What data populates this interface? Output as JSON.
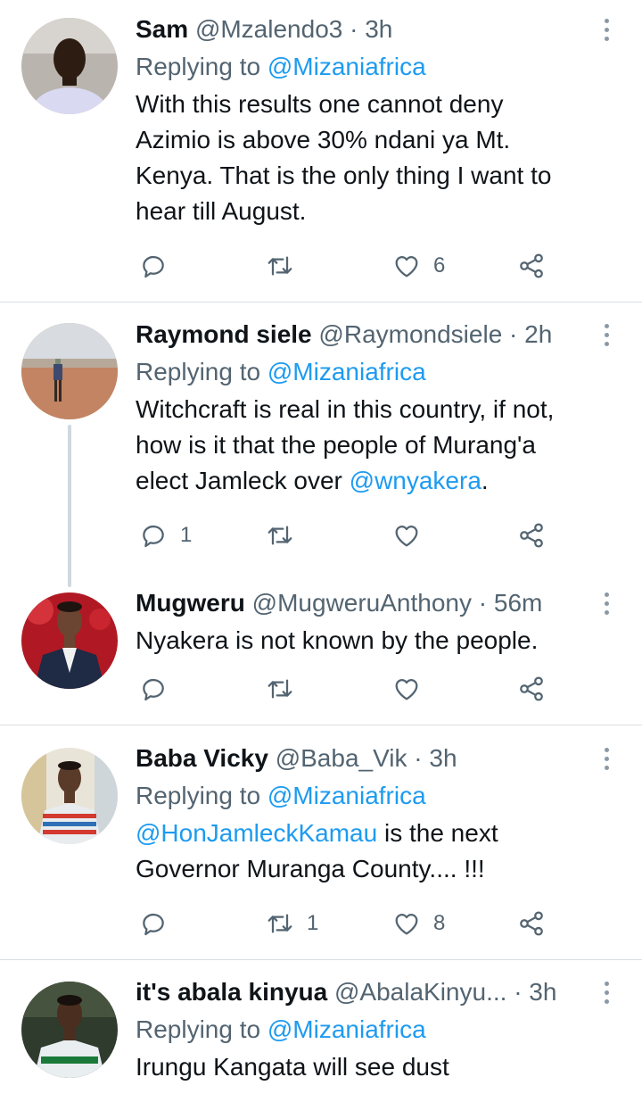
{
  "tweets": [
    {
      "name": "Sam",
      "handle": "@Mzalendo3",
      "dot": "·",
      "time": "3h",
      "replying_prefix": "Replying to",
      "replying_mention": "@Mizaniafrica",
      "text_lines": [
        "With this results one cannot deny",
        "Azimio is above 30% ndani ya Mt.",
        "Kenya. That is the only thing I want to",
        "hear till August."
      ],
      "reply_count": "",
      "retweet_count": "",
      "like_count": "6"
    },
    {
      "name": "Raymond siele",
      "handle": "@Raymondsiele",
      "dot": "·",
      "time": "2h",
      "replying_prefix": "Replying to",
      "replying_mention": "@Mizaniafrica",
      "text_lines": [
        "Witchcraft is real in this country, if not,",
        "how is it that the people of Murang'a"
      ],
      "text_last_prefix": "elect Jamleck over ",
      "text_last_mention": "@wnyakera",
      "text_last_suffix": ".",
      "reply_count": "1",
      "retweet_count": "",
      "like_count": ""
    },
    {
      "name": "Mugweru",
      "handle": "@MugweruAnthony",
      "dot": "·",
      "time": "56m",
      "text_lines": [
        "Nyakera is not known by the people."
      ],
      "reply_count": "",
      "retweet_count": "",
      "like_count": ""
    },
    {
      "name": "Baba Vicky",
      "handle": "@Baba_Vik",
      "dot": "·",
      "time": "3h",
      "replying_prefix": "Replying to",
      "replying_mention": "@Mizaniafrica",
      "text_first_mention": "@HonJamleckKamau",
      "text_first_suffix": " is the next",
      "text_lines": [
        "Governor Muranga County.... !!!"
      ],
      "reply_count": "",
      "retweet_count": "1",
      "like_count": "8"
    },
    {
      "name": "it's abala kinyua",
      "handle": "@AbalaKinyu...",
      "dot": "·",
      "time": "3h",
      "replying_prefix": "Replying to",
      "replying_mention": "@Mizaniafrica",
      "text_lines": [
        "Irungu Kangata will see dust"
      ]
    }
  ],
  "colors": {
    "link": "#1d9bf0",
    "secondary": "#536471",
    "divider": "#d9dee2"
  },
  "icons": {
    "reply": "reply-icon",
    "retweet": "retweet-icon",
    "like": "heart-icon",
    "share": "share-icon",
    "more": "more-options-icon"
  }
}
